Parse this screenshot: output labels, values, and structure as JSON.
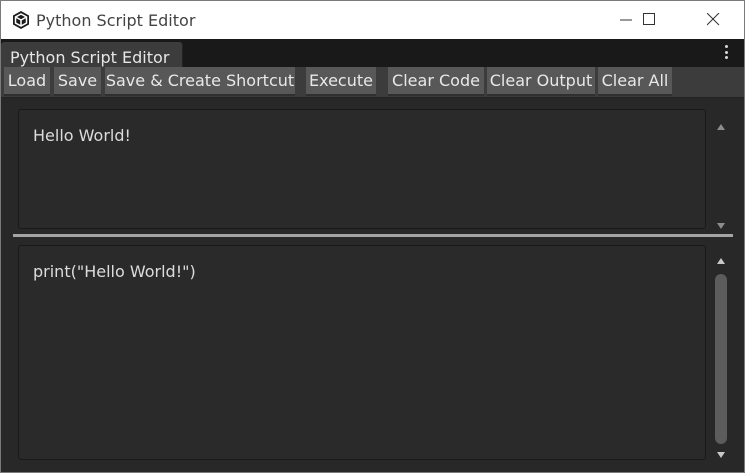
{
  "window": {
    "title": "Python Script Editor",
    "icon": "unity-cube-icon"
  },
  "tab": {
    "label": "Python Script Editor",
    "menu_icon": "kebab-menu-icon"
  },
  "toolbar": {
    "load_label": "Load",
    "save_label": "Save",
    "save_shortcut_label": "Save & Create Shortcut",
    "execute_label": "Execute",
    "clear_code_label": "Clear Code",
    "clear_output_label": "Clear Output",
    "clear_all_label": "Clear All"
  },
  "output": {
    "text": "Hello World!"
  },
  "code": {
    "text": "print(\"Hello World!\")"
  },
  "colors": {
    "background": "#282828",
    "toolbar": "#3c3c3c",
    "button": "#585858",
    "panel": "#2a2a2a",
    "splitter": "#a4a4a4"
  }
}
